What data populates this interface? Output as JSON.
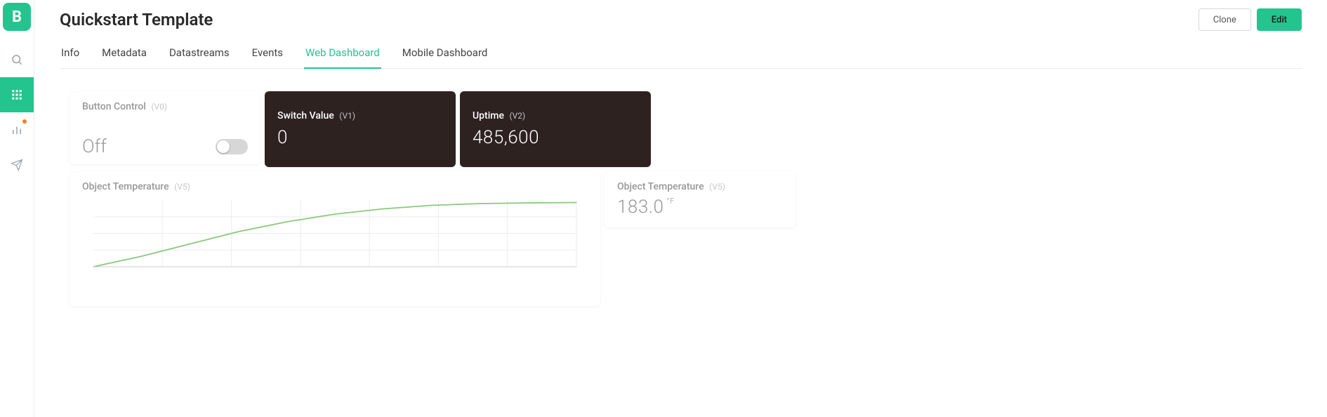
{
  "brand_letter": "B",
  "header": {
    "title": "Quickstart Template",
    "clone_label": "Clone",
    "edit_label": "Edit"
  },
  "tabs": [
    {
      "label": "Info",
      "active": false
    },
    {
      "label": "Metadata",
      "active": false
    },
    {
      "label": "Datastreams",
      "active": false
    },
    {
      "label": "Events",
      "active": false
    },
    {
      "label": "Web Dashboard",
      "active": true
    },
    {
      "label": "Mobile Dashboard",
      "active": false
    }
  ],
  "sidebar": {
    "items": [
      {
        "name": "search-icon"
      },
      {
        "name": "grid-icon",
        "active": true
      },
      {
        "name": "chart-icon",
        "notify": true
      },
      {
        "name": "send-icon"
      }
    ]
  },
  "widgets": {
    "button_control": {
      "title": "Button Control",
      "pin": "(V0)",
      "state_label": "Off",
      "on": false
    },
    "switch_value": {
      "title": "Switch Value",
      "pin": "(V1)",
      "value": "0"
    },
    "uptime": {
      "title": "Uptime",
      "pin": "(V2)",
      "value": "485,600"
    },
    "temp_chart": {
      "title": "Object Temperature",
      "pin": "(V5)"
    },
    "temp_value": {
      "title": "Object Temperature",
      "pin": "(V5)",
      "value": "183.0",
      "unit": "°F"
    }
  },
  "chart_data": {
    "type": "line",
    "title": "Object Temperature",
    "xlabel": "",
    "ylabel": "",
    "x": [
      0,
      10,
      20,
      30,
      40,
      50,
      60,
      70,
      80,
      90,
      100
    ],
    "values": [
      0,
      30,
      65,
      100,
      128,
      150,
      165,
      175,
      180,
      182,
      183
    ],
    "ylim": [
      0,
      190
    ],
    "grid": true
  }
}
